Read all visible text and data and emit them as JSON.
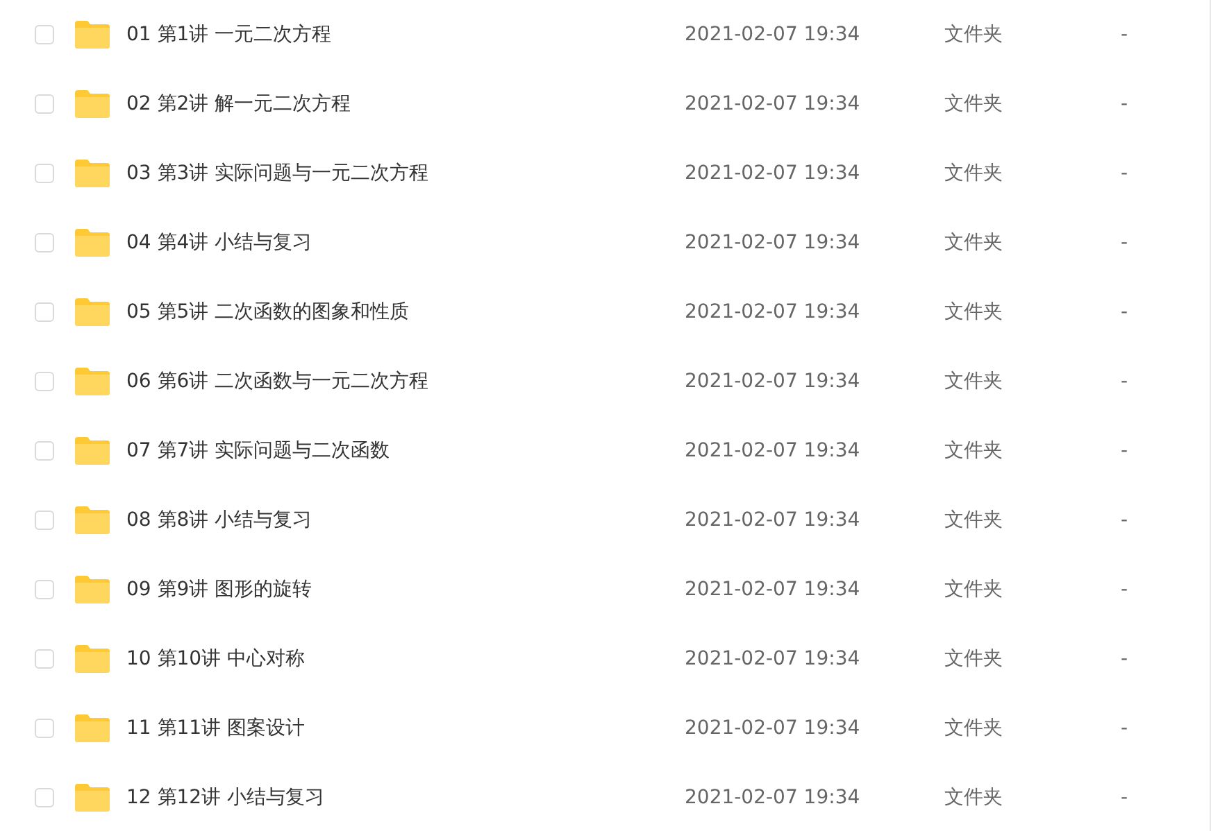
{
  "files": [
    {
      "name": "01 第1讲 一元二次方程",
      "modified": "2021-02-07 19:34",
      "type": "文件夹",
      "size": "-",
      "checked": false
    },
    {
      "name": "02 第2讲 解一元二次方程",
      "modified": "2021-02-07 19:34",
      "type": "文件夹",
      "size": "-",
      "checked": false
    },
    {
      "name": "03 第3讲 实际问题与一元二次方程",
      "modified": "2021-02-07 19:34",
      "type": "文件夹",
      "size": "-",
      "checked": false
    },
    {
      "name": "04 第4讲 小结与复习",
      "modified": "2021-02-07 19:34",
      "type": "文件夹",
      "size": "-",
      "checked": false
    },
    {
      "name": "05 第5讲 二次函数的图象和性质",
      "modified": "2021-02-07 19:34",
      "type": "文件夹",
      "size": "-",
      "checked": false
    },
    {
      "name": "06 第6讲 二次函数与一元二次方程",
      "modified": "2021-02-07 19:34",
      "type": "文件夹",
      "size": "-",
      "checked": false
    },
    {
      "name": "07 第7讲 实际问题与二次函数",
      "modified": "2021-02-07 19:34",
      "type": "文件夹",
      "size": "-",
      "checked": false
    },
    {
      "name": "08 第8讲 小结与复习",
      "modified": "2021-02-07 19:34",
      "type": "文件夹",
      "size": "-",
      "checked": false
    },
    {
      "name": "09 第9讲 图形的旋转",
      "modified": "2021-02-07 19:34",
      "type": "文件夹",
      "size": "-",
      "checked": false
    },
    {
      "name": "10 第10讲 中心对称",
      "modified": "2021-02-07 19:34",
      "type": "文件夹",
      "size": "-",
      "checked": false
    },
    {
      "name": "11 第11讲 图案设计",
      "modified": "2021-02-07 19:34",
      "type": "文件夹",
      "size": "-",
      "checked": false
    },
    {
      "name": "12 第12讲 小结与复习",
      "modified": "2021-02-07 19:34",
      "type": "文件夹",
      "size": "-",
      "checked": false
    }
  ]
}
